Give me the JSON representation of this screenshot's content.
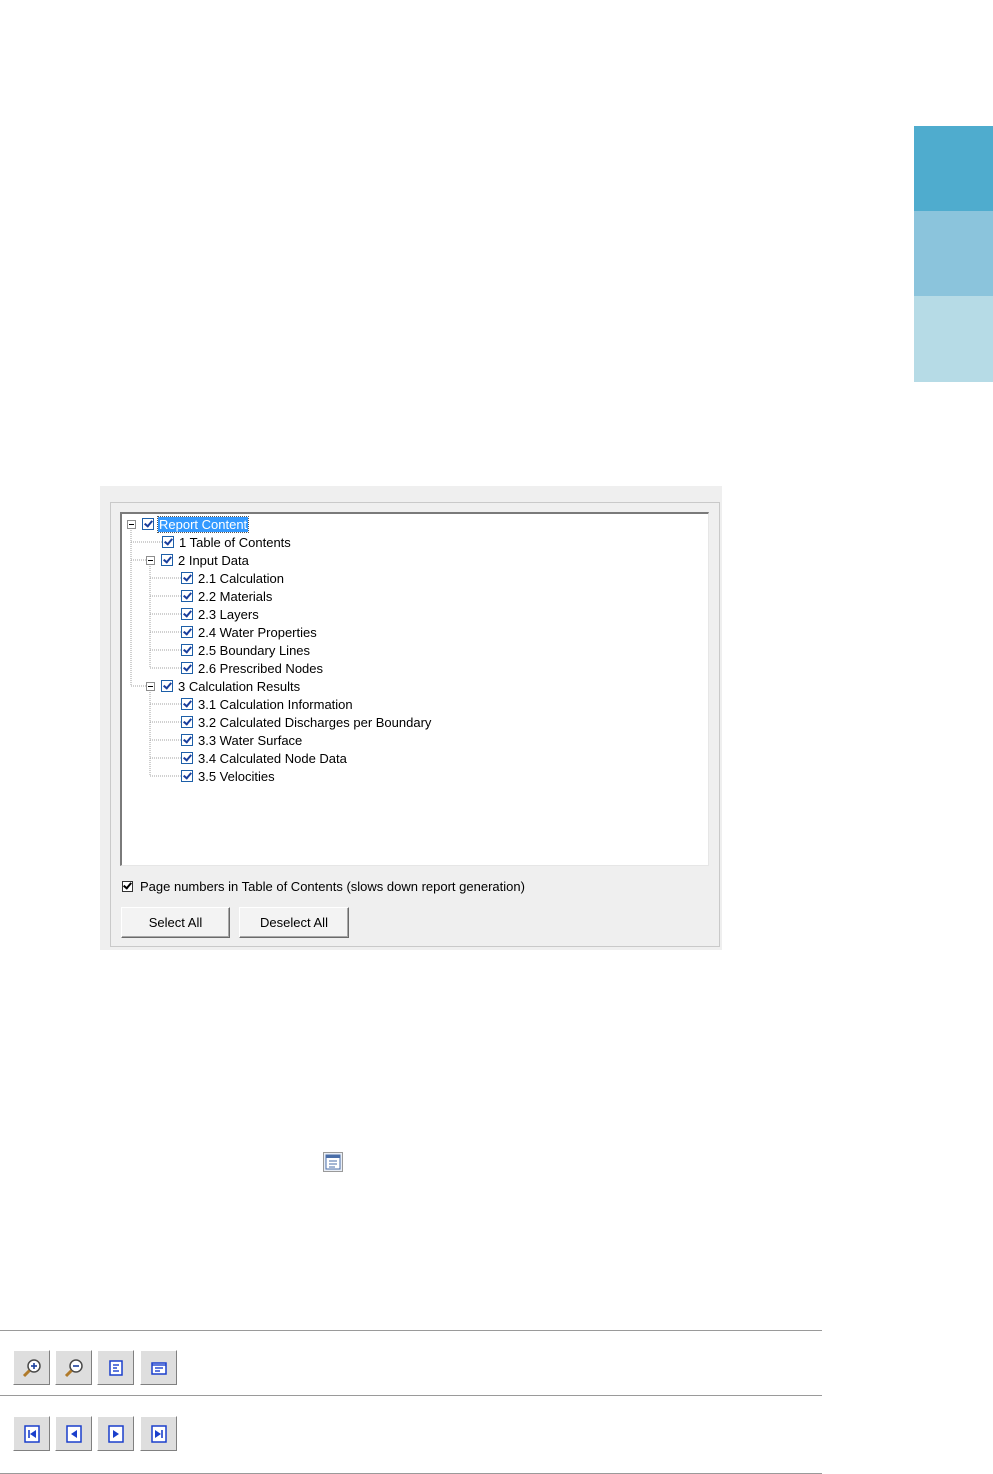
{
  "side_tabs": {
    "colors": [
      "#4facce",
      "#8bc4dc",
      "#b6dbe6"
    ]
  },
  "tree": {
    "root": {
      "label": "Report Content",
      "checked": true,
      "selected": true,
      "expanded": true
    },
    "items": [
      {
        "label": "1 Table of Contents",
        "checked": true
      },
      {
        "label": "2 Input Data",
        "checked": true,
        "expanded": true
      },
      {
        "label": "2.1 Calculation",
        "checked": true
      },
      {
        "label": "2.2 Materials",
        "checked": true
      },
      {
        "label": "2.3 Layers",
        "checked": true
      },
      {
        "label": "2.4 Water Properties",
        "checked": true
      },
      {
        "label": "2.5 Boundary Lines",
        "checked": true
      },
      {
        "label": "2.6 Prescribed Nodes",
        "checked": true
      },
      {
        "label": "3 Calculation Results",
        "checked": true,
        "expanded": true
      },
      {
        "label": "3.1 Calculation Information",
        "checked": true
      },
      {
        "label": "3.2 Calculated Discharges per Boundary",
        "checked": true
      },
      {
        "label": "3.3 Water Surface",
        "checked": true
      },
      {
        "label": "3.4 Calculated Node Data",
        "checked": true
      },
      {
        "label": "3.5 Velocities",
        "checked": true
      }
    ]
  },
  "options": {
    "page_numbers_label": "Page numbers in Table of Contents (slows down report generation)",
    "page_numbers_checked": true
  },
  "buttons": {
    "select_all": "Select All",
    "deselect_all": "Deselect All"
  },
  "toolbar_zoom": [
    "zoom-in-icon",
    "zoom-out-icon",
    "fit-page-icon",
    "fit-width-icon"
  ],
  "toolbar_nav": [
    "first-page-icon",
    "previous-page-icon",
    "next-page-icon",
    "last-page-icon"
  ]
}
